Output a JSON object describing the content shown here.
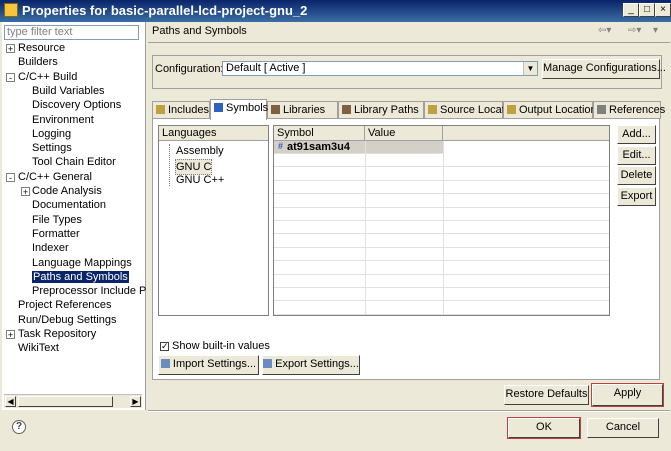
{
  "window": {
    "title": "Properties for basic-parallel-lcd-project-gnu_2"
  },
  "left": {
    "filter_placeholder": "type filter text",
    "tree": [
      {
        "label": "Resource",
        "level": 0,
        "expander": "+"
      },
      {
        "label": "Builders",
        "level": 0,
        "expander": ""
      },
      {
        "label": "C/C++ Build",
        "level": 0,
        "expander": "-"
      },
      {
        "label": "Build Variables",
        "level": 1,
        "expander": ""
      },
      {
        "label": "Discovery Options",
        "level": 1,
        "expander": ""
      },
      {
        "label": "Environment",
        "level": 1,
        "expander": ""
      },
      {
        "label": "Logging",
        "level": 1,
        "expander": ""
      },
      {
        "label": "Settings",
        "level": 1,
        "expander": ""
      },
      {
        "label": "Tool Chain Editor",
        "level": 1,
        "expander": ""
      },
      {
        "label": "C/C++ General",
        "level": 0,
        "expander": "-"
      },
      {
        "label": "Code Analysis",
        "level": 1,
        "expander": "+"
      },
      {
        "label": "Documentation",
        "level": 1,
        "expander": ""
      },
      {
        "label": "File Types",
        "level": 1,
        "expander": ""
      },
      {
        "label": "Formatter",
        "level": 1,
        "expander": ""
      },
      {
        "label": "Indexer",
        "level": 1,
        "expander": ""
      },
      {
        "label": "Language Mappings",
        "level": 1,
        "expander": ""
      },
      {
        "label": "Paths and Symbols",
        "level": 1,
        "expander": "",
        "selected": true
      },
      {
        "label": "Preprocessor Include P",
        "level": 1,
        "expander": ""
      },
      {
        "label": "Project References",
        "level": 0,
        "expander": ""
      },
      {
        "label": "Run/Debug Settings",
        "level": 0,
        "expander": ""
      },
      {
        "label": "Task Repository",
        "level": 0,
        "expander": "+"
      },
      {
        "label": "WikiText",
        "level": 0,
        "expander": ""
      }
    ]
  },
  "page": {
    "title": "Paths and Symbols",
    "configuration_label": "Configuration:",
    "configuration_value": "Default  [ Active ]",
    "manage_button": "Manage Configurations...",
    "tabs": [
      {
        "label": "Includes",
        "icon": "includes-icon"
      },
      {
        "label": "Symbols",
        "icon": "hash-icon",
        "active": true
      },
      {
        "label": "Libraries",
        "icon": "libraries-icon"
      },
      {
        "label": "Library Paths",
        "icon": "library-paths-icon"
      },
      {
        "label": "Source Location",
        "icon": "source-location-icon"
      },
      {
        "label": "Output Location",
        "icon": "output-location-icon"
      },
      {
        "label": "References",
        "icon": "references-icon"
      }
    ],
    "languages_header": "Languages",
    "languages": [
      {
        "label": "Assembly"
      },
      {
        "label": "GNU C",
        "selected": true
      },
      {
        "label": "GNU C++"
      }
    ],
    "symbol_headers": [
      "Symbol",
      "Value"
    ],
    "symbols": [
      {
        "symbol": "at91sam3u4",
        "value": ""
      }
    ],
    "side_buttons": [
      "Add...",
      "Edit...",
      "Delete",
      "Export"
    ],
    "show_builtin_label": "Show built-in values",
    "show_builtin_checked": true,
    "import_button": "Import Settings...",
    "export_button": "Export Settings..."
  },
  "footer": {
    "restore_defaults": "Restore Defaults",
    "apply": "Apply",
    "ok": "OK",
    "cancel": "Cancel"
  },
  "colors": {
    "title_bar": "#0a246a",
    "selection": "#0a246a",
    "accent_border": "#c04040"
  }
}
